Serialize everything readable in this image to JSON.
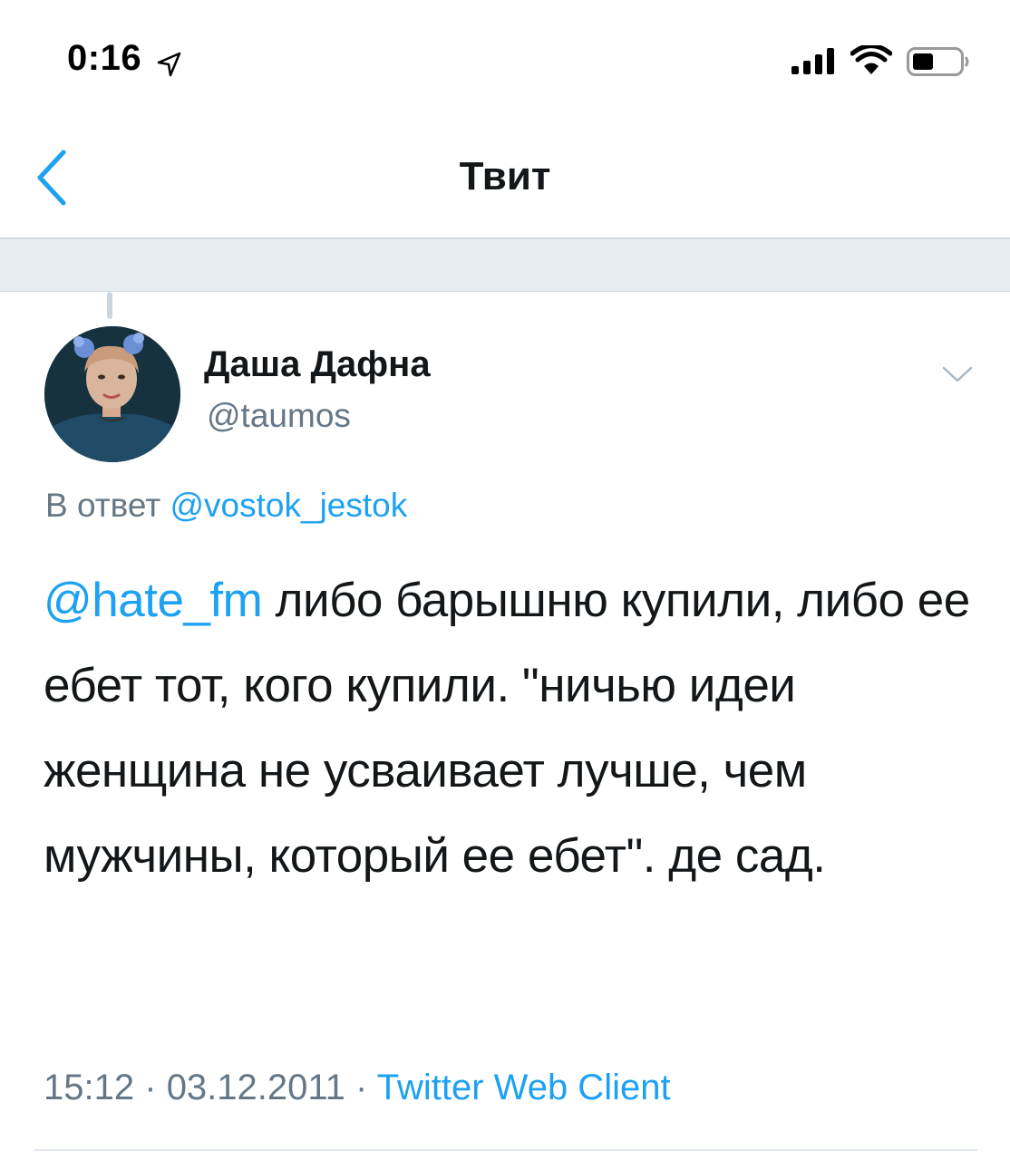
{
  "status_bar": {
    "time": "0:16",
    "location_icon": "location-arrow-icon",
    "signal_icon": "cellular-signal-icon",
    "wifi_icon": "wifi-icon",
    "battery_icon": "battery-icon"
  },
  "nav": {
    "back_icon": "chevron-left-icon",
    "title": "Твит"
  },
  "tweet": {
    "author": {
      "display_name": "Даша Дафна",
      "handle": "@taumos"
    },
    "reply_prefix": "В ответ",
    "reply_to": "@vostok_jestok",
    "mention": "@hate_fm",
    "text_after_mention": " либо барышню купили, либо ее ебет тот, кого купили. \"ничью идеи женщина не усваивает лучше, чем мужчины, который ее ебет\". де сад.",
    "meta": {
      "time": "15:12",
      "separator": "·",
      "date": "03.12.2011",
      "source": "Twitter Web Client"
    }
  },
  "colors": {
    "accent": "#1da1f2",
    "secondary_text": "#657786",
    "primary_text": "#14171a",
    "band": "#e6ecf0"
  }
}
